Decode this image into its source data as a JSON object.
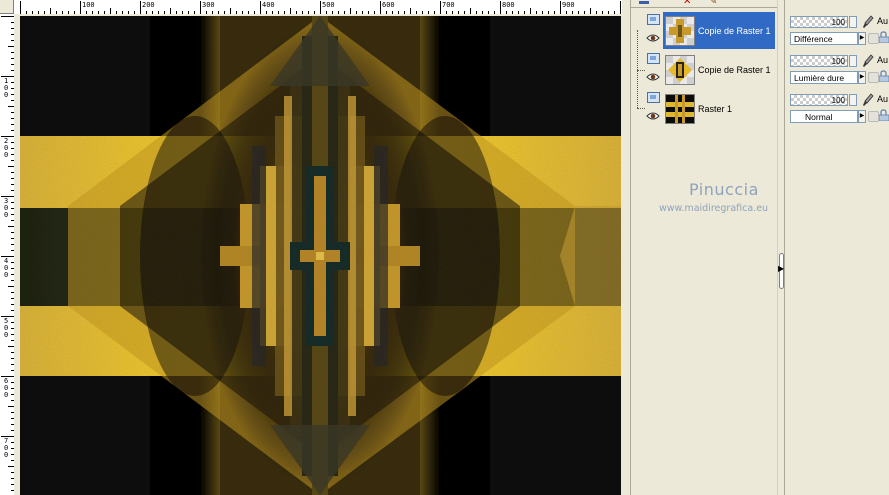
{
  "rulers": {
    "top_labels": [
      "100",
      "200",
      "300",
      "400",
      "500",
      "600",
      "700",
      "800",
      "900"
    ],
    "left_labels": [
      "100",
      "200",
      "300",
      "400",
      "500",
      "600",
      "700"
    ]
  },
  "toolbar": {
    "delete_icon": "delete-icon",
    "brush_icon": "brush-icon"
  },
  "layers": [
    {
      "name": "Copie de Raster 1",
      "selected": true,
      "thumb": "cross-gold"
    },
    {
      "name": "Copie de Raster 1",
      "selected": false,
      "thumb": "diamond-gold"
    },
    {
      "name": "Raster 1",
      "selected": false,
      "thumb": "stripes-black-gold"
    }
  ],
  "properties": [
    {
      "opacity": "100",
      "blend_mode": "Différence",
      "auto_label": "Au"
    },
    {
      "opacity": "100",
      "blend_mode": "Lumière dure",
      "auto_label": "Au"
    },
    {
      "opacity": "100",
      "blend_mode": "Normal",
      "auto_label": "Au"
    }
  ],
  "watermark": {
    "title": "Pinuccia",
    "url": "www.maidiregrafica.eu"
  },
  "colors": {
    "selection": "#316ac5",
    "panel_bg": "#ece9d8",
    "gold": "#e8c23a",
    "dark_olive": "#2d3316",
    "watermark": "#8fa3bd"
  }
}
